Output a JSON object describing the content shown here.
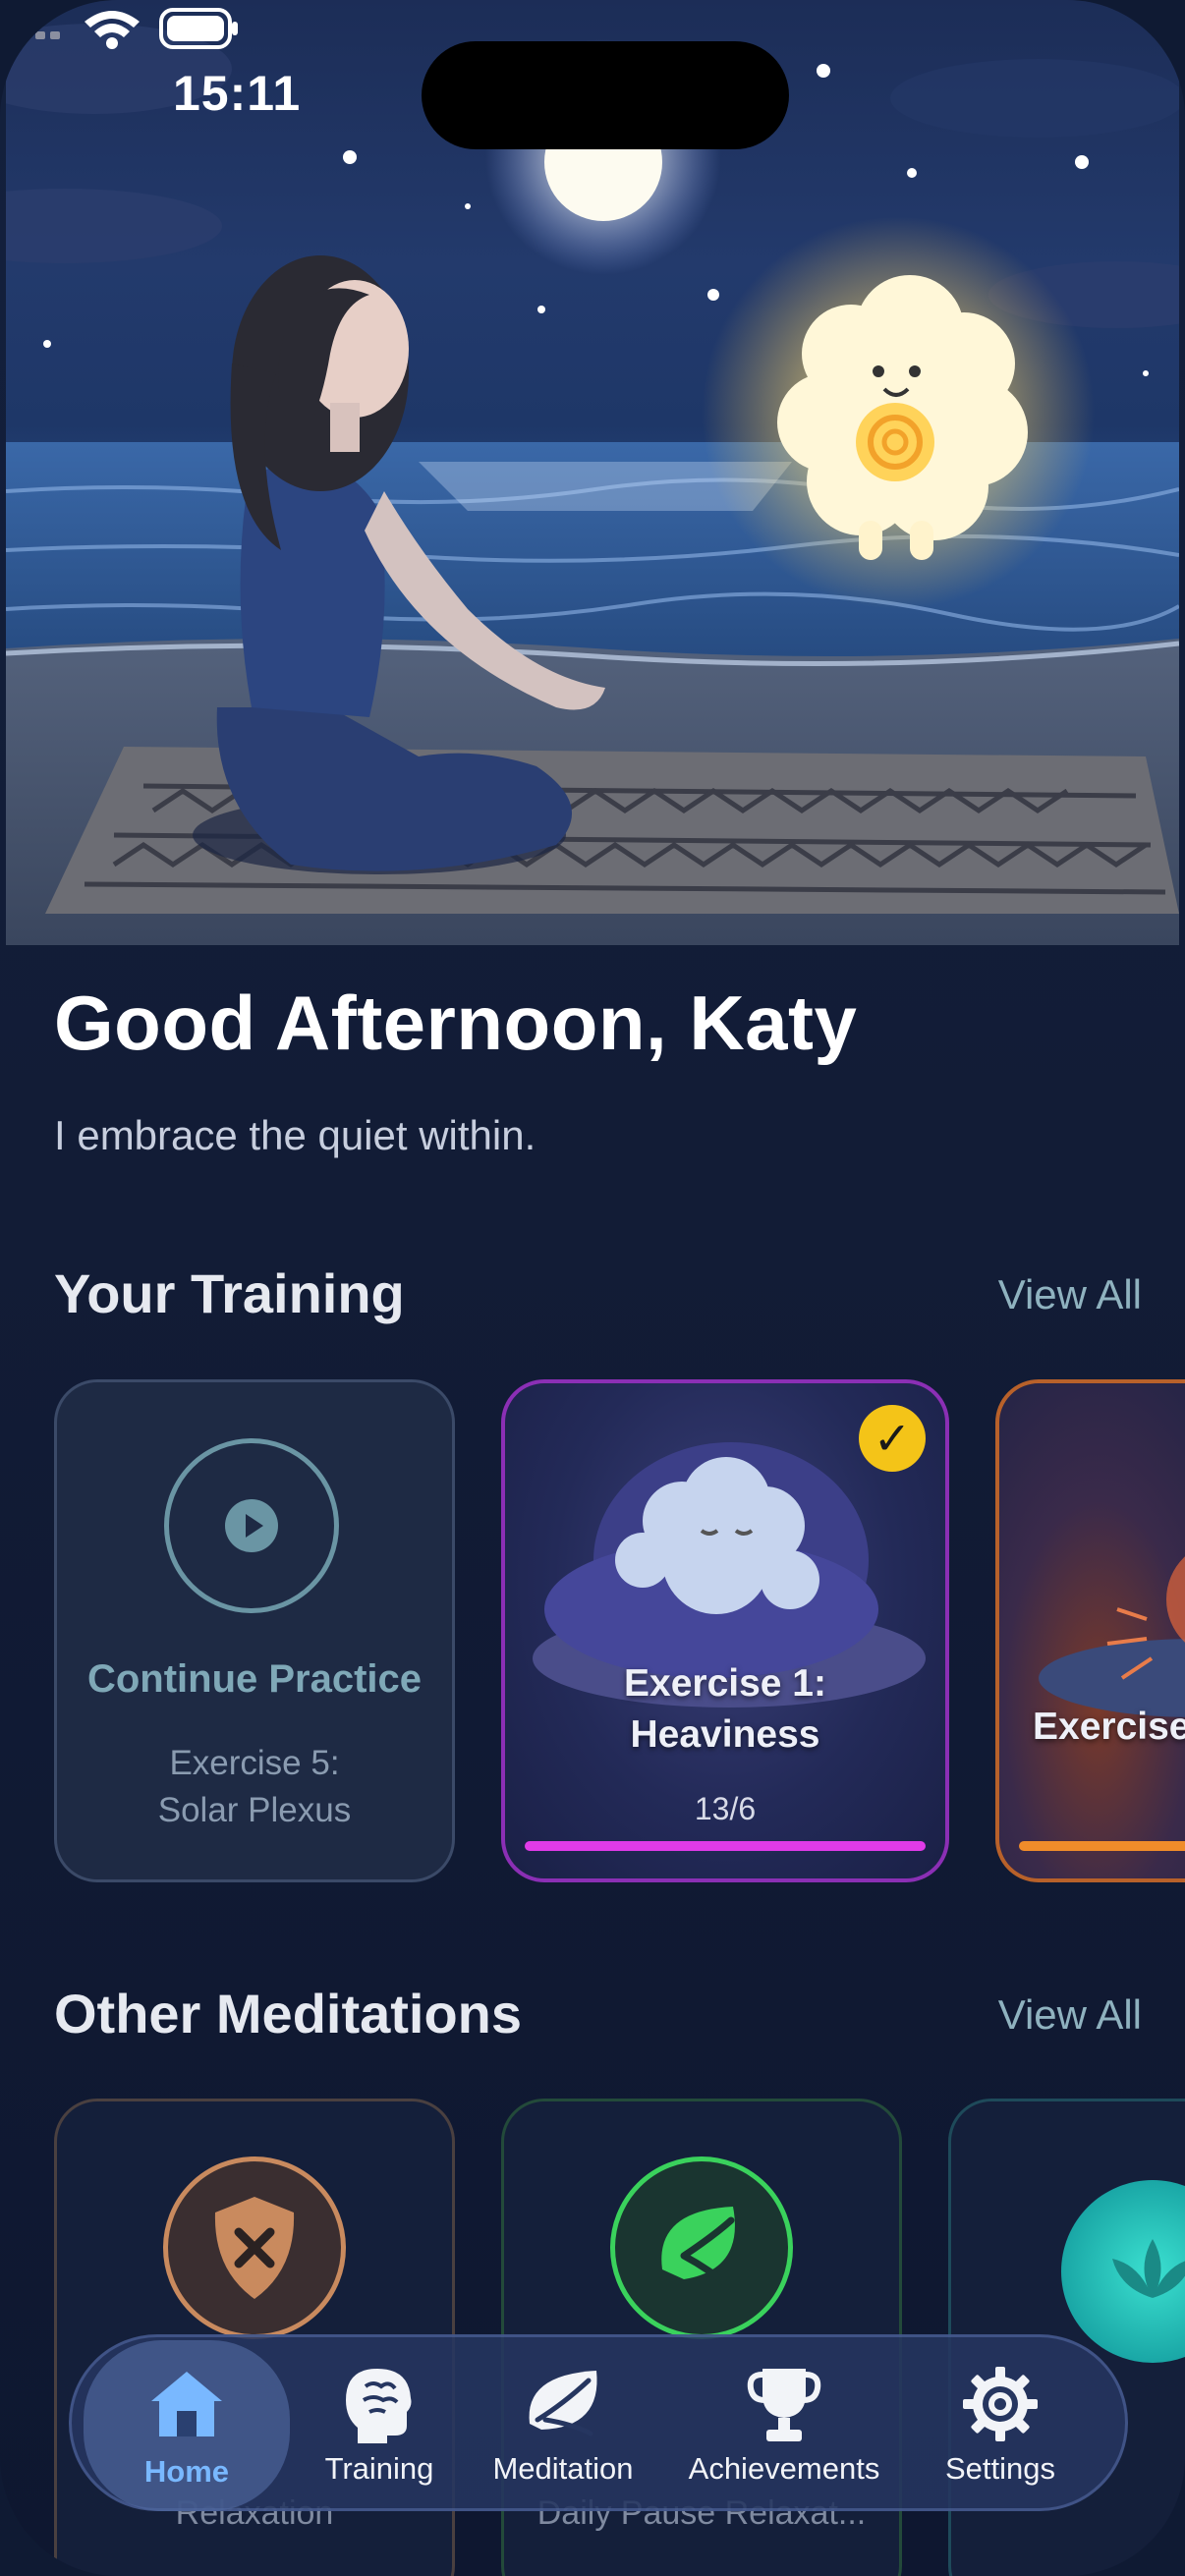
{
  "status_bar": {
    "time": "15:11"
  },
  "greeting": {
    "title": "Good Afternoon, Katy",
    "affirmation": "I embrace the quiet within."
  },
  "training": {
    "section_title": "Your Training",
    "view_all": "View All",
    "continue_card": {
      "label": "Continue Practice",
      "exercise_line1": "Exercise 5:",
      "exercise_line2": "Solar Plexus"
    },
    "cards": [
      {
        "title_line1": "Exercise 1:",
        "title_line2": "Heaviness",
        "progress_text": "13/6",
        "completed": true,
        "bar_color": "#e03be8",
        "progress": 1.0
      },
      {
        "title_line1": "Exercise",
        "title_line2": "",
        "progress_text": "",
        "completed": false,
        "bar_color": "#f08c2a",
        "progress": 1.0
      }
    ]
  },
  "meditations": {
    "section_title": "Other Meditations",
    "view_all": "View All",
    "cards": [
      {
        "icon": "shield-x-icon",
        "title": "",
        "subtitle": "Relaxation",
        "accent": "#c98a5e"
      },
      {
        "icon": "leaf-icon",
        "title": "",
        "subtitle": "Daily Pause Relaxat...",
        "accent": "#3ad25c"
      },
      {
        "icon": "lotus-icon",
        "title": "",
        "subtitle": "",
        "accent": "#2cc0b8"
      }
    ]
  },
  "tabbar": {
    "items": [
      {
        "label": "Home",
        "icon": "home-icon",
        "active": true
      },
      {
        "label": "Training",
        "icon": "brain-head-icon",
        "active": false
      },
      {
        "label": "Meditation",
        "icon": "leaf-icon",
        "active": false
      },
      {
        "label": "Achievements",
        "icon": "trophy-icon",
        "active": false
      },
      {
        "label": "Settings",
        "icon": "gear-icon",
        "active": false
      }
    ]
  },
  "colors": {
    "background": "#0f1a33",
    "accent_active_tab": "#79b8ff",
    "view_all": "#8fb2bf"
  }
}
